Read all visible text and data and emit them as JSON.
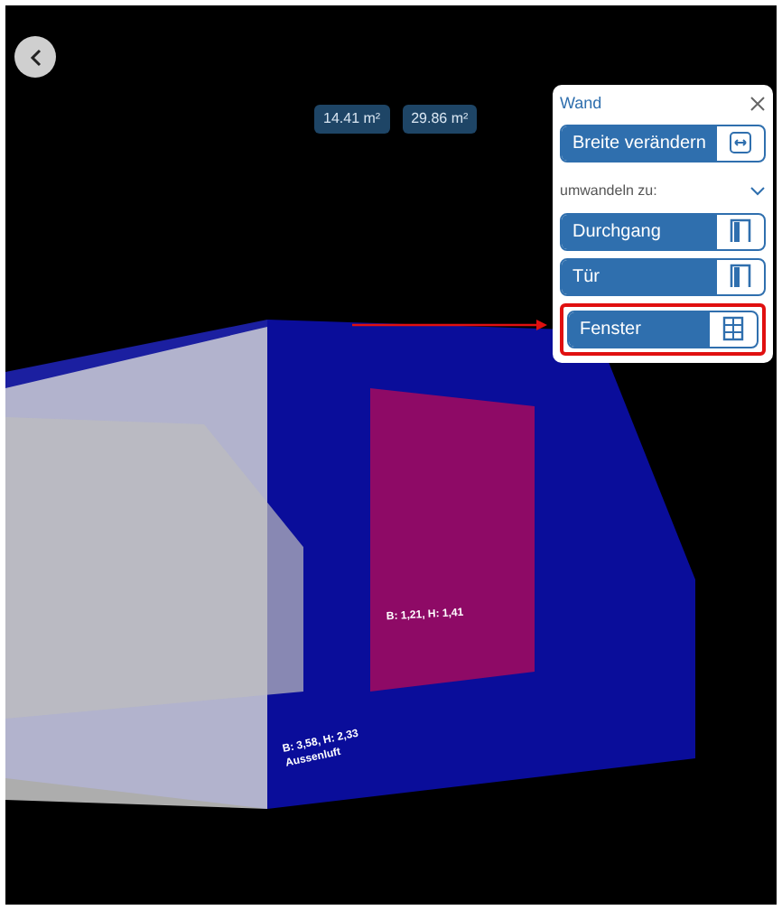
{
  "areas": [
    "14.41 m²",
    "29.86 m²"
  ],
  "panel": {
    "title": "Wand",
    "actions": [
      {
        "label": "Breite verändern",
        "kind": "width"
      }
    ],
    "section": {
      "label": "umwandeln zu:",
      "expanded": true
    },
    "options": [
      {
        "label": "Durchgang",
        "kind": "door",
        "highlighted": false
      },
      {
        "label": "Tür",
        "kind": "door",
        "highlighted": false
      },
      {
        "label": "Fenster",
        "kind": "window",
        "highlighted": true
      }
    ]
  },
  "labels": {
    "window": "B: 1,21, H: 1,41",
    "wall": [
      "B: 3,58, H: 2,33",
      "Aussenluft"
    ]
  }
}
